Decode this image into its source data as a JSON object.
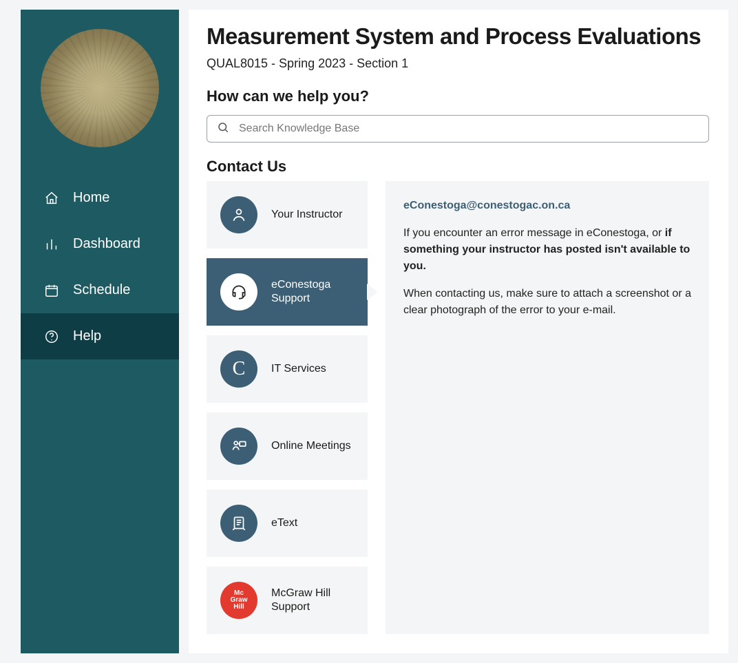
{
  "sidebar": {
    "nav": [
      {
        "label": "Home",
        "icon": "home",
        "active": false
      },
      {
        "label": "Dashboard",
        "icon": "bars",
        "active": false
      },
      {
        "label": "Schedule",
        "icon": "calendar",
        "active": false
      },
      {
        "label": "Help",
        "icon": "question",
        "active": true
      }
    ]
  },
  "page": {
    "title": "Measurement System and Process Evaluations",
    "subtitle": "QUAL8015 - Spring 2023 - Section 1",
    "help_heading": "How can we help you?",
    "contact_heading": "Contact Us"
  },
  "search": {
    "placeholder": "Search Knowledge Base",
    "value": ""
  },
  "contacts": [
    {
      "label": "Your Instructor",
      "icon": "user",
      "active": false
    },
    {
      "label": "eConestoga Support",
      "icon": "headset",
      "active": true
    },
    {
      "label": "IT Services",
      "icon": "c-letter",
      "active": false
    },
    {
      "label": "Online Meetings",
      "icon": "meeting",
      "active": false
    },
    {
      "label": "eText",
      "icon": "etext",
      "active": false
    },
    {
      "label": "McGraw Hill Support",
      "icon": "mcgraw",
      "active": false
    }
  ],
  "detail": {
    "email": "eConestoga@conestogac.on.ca",
    "p1_prefix": "If you encounter an error message in eConestoga, or ",
    "p1_bold": "if something your instructor has posted isn't available to you.",
    "p2": "When contacting us, make sure to attach a screenshot or a clear photograph of the error to your e-mail."
  }
}
